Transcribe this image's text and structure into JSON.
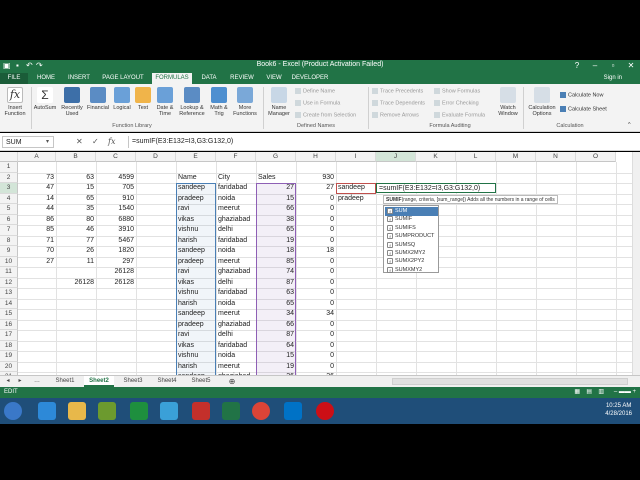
{
  "window": {
    "title": "Book6 - Excel (Product Activation Failed)"
  },
  "ribbon_tabs": [
    "FILE",
    "HOME",
    "INSERT",
    "PAGE LAYOUT",
    "FORMULAS",
    "DATA",
    "REVIEW",
    "VIEW",
    "DEVELOPER"
  ],
  "user": "Sign in",
  "ribbon": {
    "insert_function": "Insert Function",
    "autosum": "AutoSum",
    "recently_used": "Recently Used",
    "financial": "Financial",
    "logical": "Logical",
    "text": "Text",
    "date_time": "Date & Time",
    "lookup": "Lookup & Reference",
    "math": "Math & Trig",
    "more": "More Functions",
    "function_library": "Function Library",
    "name_manager": "Name Manager",
    "define_name": "Define Name",
    "use_in_formula": "Use in Formula",
    "create_from_selection": "Create from Selection",
    "defined_names": "Defined Names",
    "trace_precedents": "Trace Precedents",
    "trace_dependents": "Trace Dependents",
    "remove_arrows": "Remove Arrows",
    "show_formulas": "Show Formulas",
    "error_checking": "Error Checking",
    "evaluate_formula": "Evaluate Formula",
    "watch_window": "Watch Window",
    "formula_auditing": "Formula Auditing",
    "calc_options": "Calculation Options",
    "calc_now": "Calculate Now",
    "calc_sheet": "Calculate Sheet",
    "calculation": "Calculation"
  },
  "formula_bar": {
    "name_box": "SUM",
    "formula": "=sumIF(E3:E132=I3,G3:G132,0)"
  },
  "columns": [
    "A",
    "B",
    "C",
    "D",
    "E",
    "F",
    "G",
    "H",
    "I",
    "J",
    "K",
    "L",
    "M",
    "N",
    "O"
  ],
  "rows": [
    "1",
    "2",
    "3",
    "4",
    "5",
    "6",
    "7",
    "8",
    "9",
    "10",
    "11",
    "12",
    "13",
    "14",
    "15",
    "16",
    "17",
    "18",
    "19",
    "20",
    "21"
  ],
  "cells": {
    "A": [
      "",
      "73",
      "47",
      "14",
      "44",
      "86",
      "85",
      "71",
      "70",
      "27",
      "",
      "",
      "",
      "",
      "",
      "",
      "",
      "",
      "",
      "",
      ""
    ],
    "B": [
      "",
      "63",
      "15",
      "65",
      "35",
      "80",
      "46",
      "77",
      "26",
      "11",
      "",
      "26128",
      "",
      "",
      "",
      "",
      "",
      "",
      "",
      "",
      ""
    ],
    "C": [
      "",
      "4599",
      "705",
      "910",
      "1540",
      "6880",
      "3910",
      "5467",
      "1820",
      "297",
      "26128",
      "26128",
      "",
      "",
      "",
      "",
      "",
      "",
      "",
      "",
      ""
    ],
    "E": [
      "",
      "Name",
      "sandeep",
      "pradeep",
      "ravi",
      "vikas",
      "vishnu",
      "harish",
      "sandeep",
      "pradeep",
      "ravi",
      "vikas",
      "vishnu",
      "harish",
      "sandeep",
      "pradeep",
      "ravi",
      "vikas",
      "vishnu",
      "harish",
      "sandeep"
    ],
    "F": [
      "",
      "City",
      "faridabad",
      "noida",
      "meerut",
      "ghaziabad",
      "delhi",
      "faridabad",
      "noida",
      "meerut",
      "ghaziabad",
      "delhi",
      "faridabad",
      "noida",
      "meerut",
      "ghaziabad",
      "delhi",
      "faridabad",
      "noida",
      "meerut",
      "ghaziabad"
    ],
    "G": [
      "",
      "Sales",
      "27",
      "15",
      "66",
      "38",
      "65",
      "19",
      "18",
      "85",
      "74",
      "87",
      "63",
      "65",
      "34",
      "66",
      "87",
      "64",
      "15",
      "19",
      "26"
    ],
    "H": [
      "",
      "930",
      "27",
      "0",
      "0",
      "0",
      "0",
      "0",
      "18",
      "0",
      "0",
      "0",
      "0",
      "0",
      "34",
      "0",
      "0",
      "0",
      "0",
      "0",
      "26"
    ],
    "I": [
      "",
      "",
      "sandeep",
      "pradeep",
      "",
      "",
      "",
      "",
      "",
      "",
      "",
      "",
      "",
      "",
      "",
      "",
      "",
      "",
      "",
      "",
      ""
    ]
  },
  "editing_cell_text": "=sumIF(E3:E132=I3,G3:G132,0)",
  "tooltip": {
    "fn": "SUMIF",
    "args": "(range, criteria, [sum_range])",
    "desc": "Adds all the numbers in a range of cells"
  },
  "autocomplete": [
    "SUM",
    "SUMIF",
    "SUMIFS",
    "SUMPRODUCT",
    "SUMSQ",
    "SUMX2MY2",
    "SUMX2PY2",
    "SUMXMY2"
  ],
  "sheets": [
    "Sheet1",
    "Sheet2",
    "Sheet3",
    "Sheet4",
    "Sheet5"
  ],
  "status": "EDIT",
  "clock": {
    "time": "10:25 AM",
    "date": "4/28/2016"
  },
  "colors": {
    "excel_green": "#217346",
    "taskbar": "#1f4e79",
    "selection": "#4a7fb5"
  }
}
